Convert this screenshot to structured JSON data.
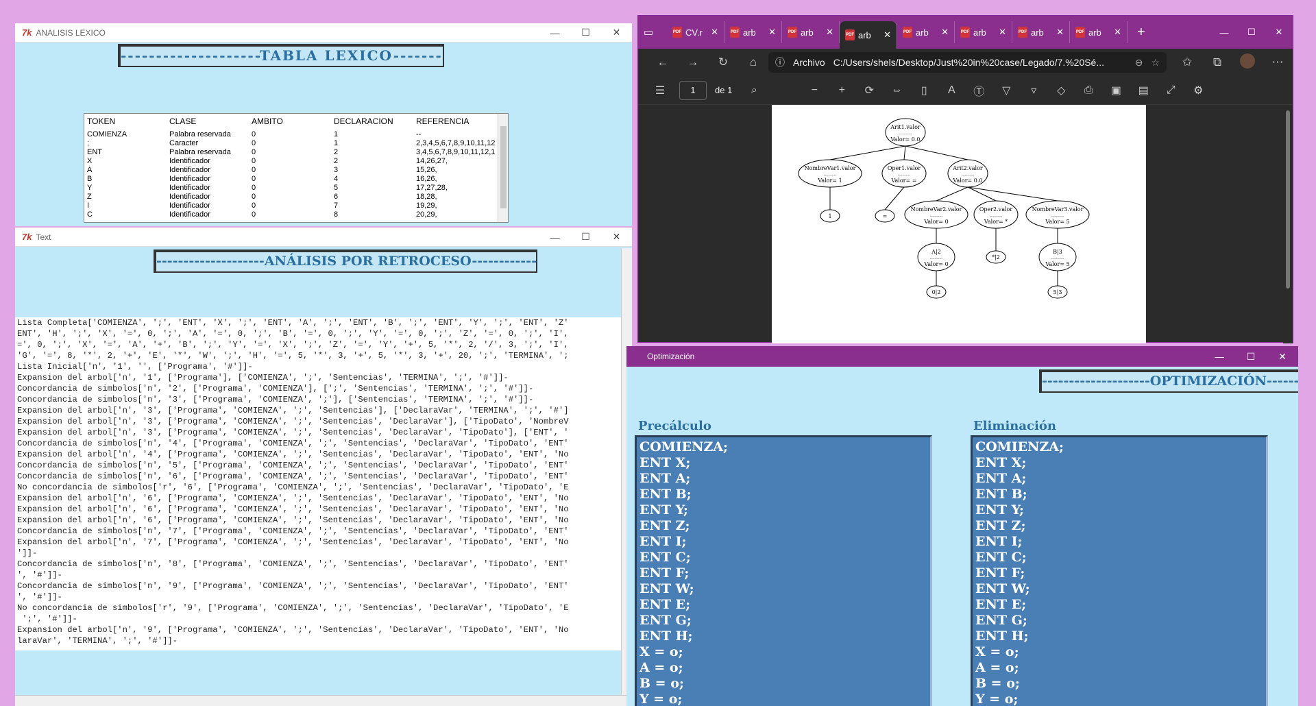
{
  "lexico": {
    "title": "ANALISIS LEXICO",
    "banner": "--------------------TABLA LEXICO--------------------",
    "headers": [
      "TOKEN",
      "CLASE",
      "AMBITO",
      "DECLARACION",
      "REFERENCIA"
    ],
    "rows": [
      [
        "COMIENZA",
        "Palabra reservada",
        "0",
        "1",
        "--"
      ],
      [
        ";",
        "Caracter",
        "0",
        "1",
        "2,3,4,5,6,7,8,9,10,11,12"
      ],
      [
        "ENT",
        "Palabra reservada",
        "0",
        "2",
        "3,4,5,6,7,8,9,10,11,12,1"
      ],
      [
        "X",
        "Identificador",
        "0",
        "2",
        "14,26,27,"
      ],
      [
        "A",
        "Identificador",
        "0",
        "3",
        "15,26,"
      ],
      [
        "B",
        "Identificador",
        "0",
        "4",
        "16,26,"
      ],
      [
        "Y",
        "Identificador",
        "0",
        "5",
        "17,27,28,"
      ],
      [
        "Z",
        "Identificador",
        "0",
        "6",
        "18,28,"
      ],
      [
        "I",
        "Identificador",
        "0",
        "7",
        "19,29,"
      ],
      [
        "C",
        "Identificador",
        "0",
        "8",
        "20,29,"
      ]
    ]
  },
  "text": {
    "title": "Text",
    "banner": "--------------------ANÁLISIS POR RETROCESO--------------------",
    "lines": [
      "Lista Completa['COMIENZA', ';', 'ENT', 'X', ';', 'ENT', 'A', ';', 'ENT', 'B', ';', 'ENT', 'Y', ';', 'ENT', 'Z'",
      "ENT', 'H', ';', 'X', '=', 0, ';', 'A', '=', 0, ';', 'B', '=', 0, ';', 'Y', '=', 0, ';', 'Z', '=', 0, ';', 'I',",
      "=', 0, ';', 'X', '=', 'A', '+', 'B', ';', 'Y', '=', 'X', ';', 'Z', '=', 'Y', '+', 5, '*', 2, '/', 3, ';', 'I',",
      "'G', '=', 8, '*', 2, '+', 'E', '*', 'W', ';', 'H', '=', 5, '*', 3, '+', 5, '*', 3, '+', 20, ';', 'TERMINA', ';",
      "Lista Inicial['n', '1', '', ['Programa', '#']]-",
      "Expansion del arbol['n', '1', ['Programa'], ['COMIENZA', ';', 'Sentencias', 'TERMINA', ';', '#']]-",
      "Concordancia de simbolos['n', '2', ['Programa', 'COMIENZA'], [';', 'Sentencias', 'TERMINA', ';', '#']]-",
      "Concordancia de simbolos['n', '3', ['Programa', 'COMIENZA', ';'], ['Sentencias', 'TERMINA', ';', '#']]-",
      "Expansion del arbol['n', '3', ['Programa', 'COMIENZA', ';', 'Sentencias'], ['DeclaraVar', 'TERMINA', ';', '#']",
      "Expansion del arbol['n', '3', ['Programa', 'COMIENZA', ';', 'Sentencias', 'DeclaraVar'], ['TipoDato', 'NombreV",
      "Expansion del arbol['n', '3', ['Programa', 'COMIENZA', ';', 'Sentencias', 'DeclaraVar', 'TipoDato'], ['ENT', '",
      "Concordancia de simbolos['n', '4', ['Programa', 'COMIENZA', ';', 'Sentencias', 'DeclaraVar', 'TipoDato', 'ENT'",
      "Expansion del arbol['n', '4', ['Programa', 'COMIENZA', ';', 'Sentencias', 'DeclaraVar', 'TipoDato', 'ENT', 'No",
      "Concordancia de simbolos['n', '5', ['Programa', 'COMIENZA', ';', 'Sentencias', 'DeclaraVar', 'TipoDato', 'ENT'",
      "Concordancia de simbolos['n', '6', ['Programa', 'COMIENZA', ';', 'Sentencias', 'DeclaraVar', 'TipoDato', 'ENT'",
      "No concordancia de simbolos['r', '6', ['Programa', 'COMIENZA', ';', 'Sentencias', 'DeclaraVar', 'TipoDato', 'E",
      "Expansion del arbol['n', '6', ['Programa', 'COMIENZA', ';', 'Sentencias', 'DeclaraVar', 'TipoDato', 'ENT', 'No",
      "Expansion del arbol['n', '6', ['Programa', 'COMIENZA', ';', 'Sentencias', 'DeclaraVar', 'TipoDato', 'ENT', 'No",
      "Expansion del arbol['n', '6', ['Programa', 'COMIENZA', ';', 'Sentencias', 'DeclaraVar', 'TipoDato', 'ENT', 'No",
      "Concordancia de simbolos['n', '7', ['Programa', 'COMIENZA', ';', 'Sentencias', 'DeclaraVar', 'TipoDato', 'ENT'",
      "Expansion del arbol['n', '7', ['Programa', 'COMIENZA', ';', 'Sentencias', 'DeclaraVar', 'TipoDato', 'ENT', 'No",
      "']]-",
      "Concordancia de simbolos['n', '8', ['Programa', 'COMIENZA', ';', 'Sentencias', 'DeclaraVar', 'TipoDato', 'ENT'",
      "', '#']]-",
      "Concordancia de simbolos['n', '9', ['Programa', 'COMIENZA', ';', 'Sentencias', 'DeclaraVar', 'TipoDato', 'ENT'",
      "', '#']]-",
      "No concordancia de simbolos['r', '9', ['Programa', 'COMIENZA', ';', 'Sentencias', 'DeclaraVar', 'TipoDato', 'E",
      " ';', '#']]-",
      "Expansion del arbol['n', '9', ['Programa', 'COMIENZA', ';', 'Sentencias', 'DeclaraVar', 'TipoDato', 'ENT', 'No",
      "laraVar', 'TERMINA', ';', '#']]-"
    ]
  },
  "browser": {
    "tabs": [
      "CV.r",
      "arb",
      "arb",
      "arb",
      "arb",
      "arb",
      "arb",
      "arb"
    ],
    "active_tab": 3,
    "archivo": "Archivo",
    "url": "C:/Users/shels/Desktop/Just%20in%20case/Legado/7.%20Sé...",
    "page": "1",
    "page_of": "de 1"
  },
  "tree": {
    "nodes": [
      {
        "l1": "Arit1.valor",
        "l2": "-----------",
        "l3": "Valor= 0.0"
      },
      {
        "l1": "NombreVar1.valor",
        "l2": "-----------",
        "l3": "Valor= 1"
      },
      {
        "l1": "Oper1.valor",
        "l2": "-----------",
        "l3": "Valor= ="
      },
      {
        "l1": "Arit2.valor",
        "l2": "-----------",
        "l3": "Valor= 0.0"
      },
      {
        "l1": "1",
        "l2": "",
        "l3": ""
      },
      {
        "l1": "=",
        "l2": "",
        "l3": ""
      },
      {
        "l1": "NombreVar2.valor",
        "l2": "-----------",
        "l3": "Valor= 0"
      },
      {
        "l1": "Oper2.valor",
        "l2": "-----------",
        "l3": "Valor= *"
      },
      {
        "l1": "NombreVar3.valor",
        "l2": "-----------",
        "l3": "Valor= 5"
      },
      {
        "l1": "A|2",
        "l2": "-----------",
        "l3": "Valor= 0"
      },
      {
        "l1": "*|2",
        "l2": "",
        "l3": ""
      },
      {
        "l1": "B|3",
        "l2": "-----------",
        "l3": "Valor= 5"
      },
      {
        "l1": "0|2",
        "l2": "",
        "l3": ""
      },
      {
        "l1": "5|3",
        "l2": "",
        "l3": ""
      }
    ]
  },
  "optim": {
    "title": "Optimización",
    "banner": "--------------------OPTIMIZACIÓN--------------------",
    "precalc_title": "Precálculo",
    "elim_title": "Eliminación",
    "precalc_lines": [
      "COMIENZA;",
      "ENT X;",
      "ENT A;",
      "ENT B;",
      "ENT Y;",
      "ENT Z;",
      "ENT I;",
      "ENT C;",
      "ENT F;",
      "ENT W;",
      "ENT E;",
      "ENT G;",
      "ENT H;",
      "X = o;",
      "A = o;",
      "B = o;",
      "Y = o;"
    ],
    "elim_lines": [
      "COMIENZA;",
      "ENT X;",
      "ENT A;",
      "ENT B;",
      "ENT Y;",
      "ENT Z;",
      "ENT I;",
      "ENT C;",
      "ENT F;",
      "ENT W;",
      "ENT E;",
      "ENT G;",
      "ENT H;",
      "X = o;",
      "A = o;",
      "B = o;",
      "Y = o;"
    ]
  }
}
